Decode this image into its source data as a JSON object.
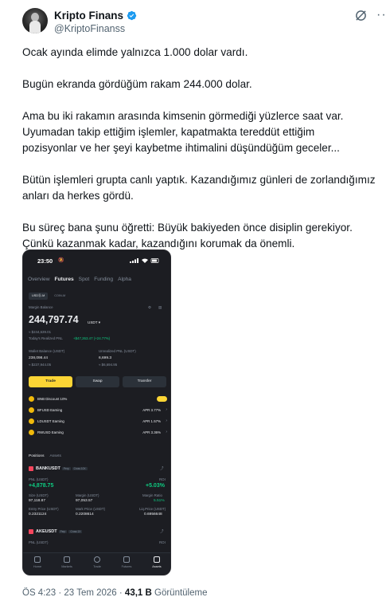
{
  "author": {
    "name": "Kripto Finans",
    "handle": "@KriptoFinanss",
    "verified_color": "#1d9bf0"
  },
  "tweet": {
    "paragraphs": [
      [
        "Ocak ayında elimde yalnızca 1.000 dolar vardı."
      ],
      [
        "Bugün ekranda gördüğüm rakam 244.000 dolar."
      ],
      [
        "Ama bu iki rakamın arasında kimsenin görmediği yüzlerce saat var.",
        "Uyumadan takip ettiğim işlemler, kapatmakta tereddüt ettiğim",
        "pozisyonlar ve her şeyi kaybetme ihtimalini düşündüğüm geceler..."
      ],
      [
        "Bütün işlemleri grupta canlı yaptık. Kazandığımız günleri de zorlandığımız",
        "anları da herkes gördü."
      ],
      [
        "Bu süreç bana şunu öğretti: Büyük bakiyeden önce disiplin gerekiyor.",
        "Çünkü kazanmak kadar, kazandığını korumak da önemli."
      ]
    ]
  },
  "phone": {
    "time": "23:50",
    "tabs": [
      "Overview",
      "Futures",
      "Spot",
      "Funding",
      "Alpha"
    ],
    "active_tab": "Futures",
    "subtabs": [
      "USDⓈ-M",
      "COIN-M"
    ],
    "margin_balance_label": "Margin Balance",
    "margin_balance": "244,797.74",
    "margin_unit": "USDT ▾",
    "margin_usd": "≈ $244,639.01",
    "realized_pnl_label": "Today's Realized PNL",
    "realized_pnl": "+$47,263.47 (+24.77%)",
    "wallet_balance_label": "Wallet Balance (USDT)",
    "wallet_balance": "238,098.44",
    "wallet_usd": "≈ $237,944.05",
    "unrealized_pnl_label": "Unrealized PNL (USDT)",
    "unrealized_pnl": "6,699.3",
    "unrealized_usd": "≈ $6,694.95",
    "buttons": [
      "Trade",
      "Swap",
      "Transfer"
    ],
    "earn_rows": [
      {
        "label": "BNB Discount 10%",
        "apr": ""
      },
      {
        "label": "BFUSD Earning",
        "apr": "APR 3.77%"
      },
      {
        "label": "LDUSDT Earning",
        "apr": "APR 1.57%"
      },
      {
        "label": "RWUSD Earning",
        "apr": "APR 3.36%"
      }
    ],
    "pos_tabs": [
      "Positions",
      "Assets"
    ],
    "positions": [
      {
        "symbol": "BANKUSDT",
        "badges": [
          "Perp",
          "Cross 10X"
        ],
        "pnl_label": "PNL (USDT)",
        "pnl": "+4,878.75",
        "roi_label": "ROI",
        "roi": "+5.03%",
        "size_label": "Size (USDT)",
        "size": "97,118.87",
        "margin_label": "Margin (USDT)",
        "margin": "97,053.57",
        "ratio_label": "Margin Ratio",
        "ratio": "5.51%",
        "entry_label": "Entry Price (USDT)",
        "entry": "0.2321124",
        "mark_label": "Mark Price (USDT)",
        "mark": "0.2208614",
        "liq_label": "Liq.Price (USDT)",
        "liq": "0.6956648"
      },
      {
        "symbol": "AKEUSDT",
        "badges": [
          "Perp",
          "Cross 1X"
        ],
        "pnl_label": "PNL (USDT)",
        "roi_label": "ROI"
      }
    ],
    "nav": [
      "Home",
      "Markets",
      "Trade",
      "Futures",
      "Assets"
    ],
    "active_nav": "Assets"
  },
  "footer": {
    "time_date": "ÖS 4:23 · 23 Tem 2026 · ",
    "views": "43,1 B",
    "views_label": " Görüntüleme"
  }
}
